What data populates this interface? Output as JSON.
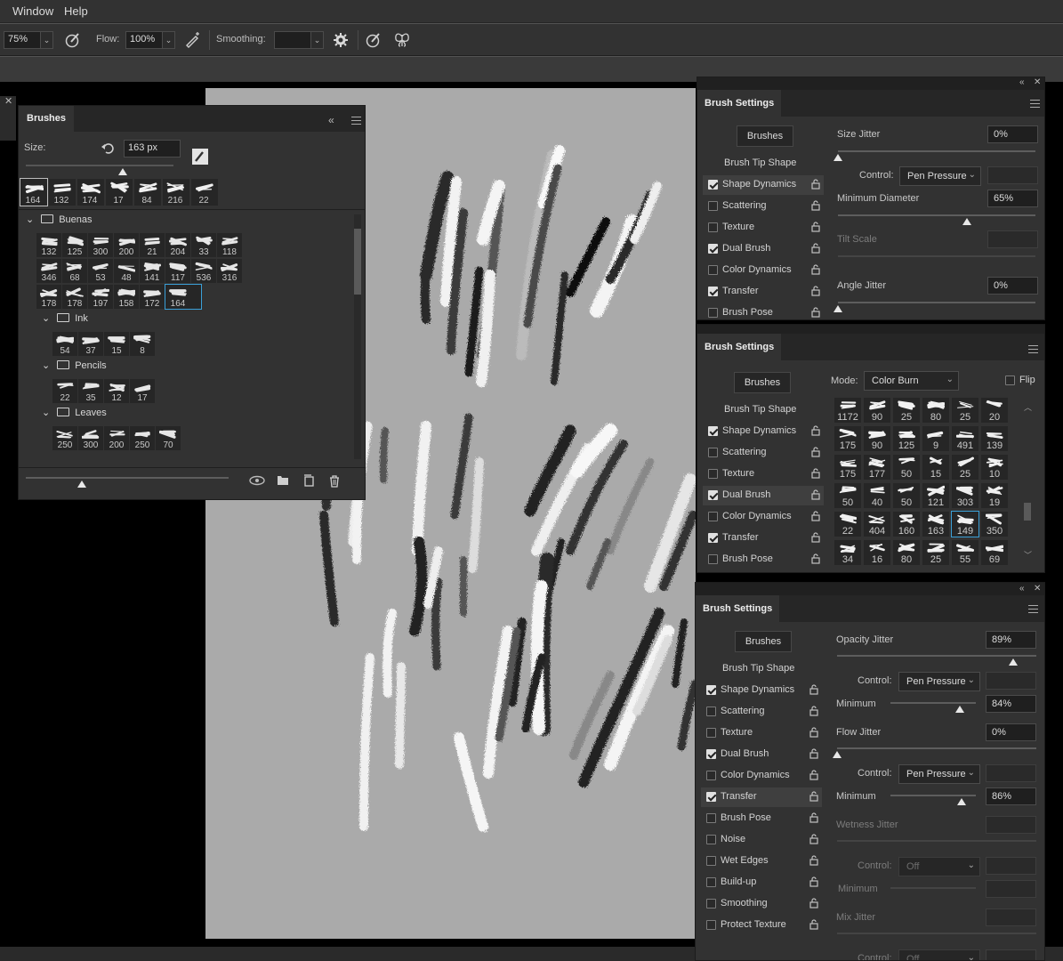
{
  "menubar": {
    "items": [
      "Window",
      "Help"
    ]
  },
  "options_bar": {
    "opacity_value": "75%",
    "flow_label": "Flow:",
    "flow_value": "100%",
    "smoothing_label": "Smoothing:",
    "smoothing_value": ""
  },
  "brushes_panel": {
    "title": "Brushes",
    "size_label": "Size:",
    "size_value": "163 px",
    "recent": [
      "164",
      "132",
      "174",
      "17",
      "84",
      "216",
      "22"
    ],
    "groups": [
      {
        "name": "Buenas",
        "rows": [
          [
            "132",
            "125",
            "300",
            "200",
            "21",
            "204",
            "33",
            "118"
          ],
          [
            "346",
            "68",
            "53",
            "48",
            "141",
            "117",
            "536",
            "316"
          ],
          [
            "178",
            "178",
            "197",
            "158",
            "172",
            "164"
          ]
        ]
      },
      {
        "name": "Ink",
        "rows": [
          [
            "54",
            "37",
            "15",
            "8"
          ]
        ]
      },
      {
        "name": "Pencils",
        "rows": [
          [
            "22",
            "35",
            "12",
            "17"
          ]
        ]
      },
      {
        "name": "Leaves",
        "rows": [
          [
            "250",
            "300",
            "200",
            "250",
            "70"
          ]
        ]
      }
    ]
  },
  "bs1": {
    "title": "Brush Settings",
    "brushes_button": "Brushes",
    "items": [
      {
        "label": "Brush Tip Shape",
        "checkbox": null
      },
      {
        "label": "Shape Dynamics",
        "checkbox": true,
        "selected": true
      },
      {
        "label": "Scattering",
        "checkbox": false
      },
      {
        "label": "Texture",
        "checkbox": false
      },
      {
        "label": "Dual Brush",
        "checkbox": true
      },
      {
        "label": "Color Dynamics",
        "checkbox": false
      },
      {
        "label": "Transfer",
        "checkbox": true
      },
      {
        "label": "Brush Pose",
        "checkbox": false
      }
    ],
    "size_jitter_label": "Size Jitter",
    "size_jitter_value": "0%",
    "control_label": "Control:",
    "control_value": "Pen Pressure",
    "min_diameter_label": "Minimum Diameter",
    "min_diameter_value": "65%",
    "tilt_scale_label": "Tilt Scale",
    "angle_jitter_label": "Angle Jitter",
    "angle_jitter_value": "0%"
  },
  "bs2": {
    "title": "Brush Settings",
    "brushes_button": "Brushes",
    "mode_label": "Mode:",
    "mode_value": "Color Burn",
    "flip_label": "Flip",
    "items": [
      {
        "label": "Brush Tip Shape",
        "checkbox": null
      },
      {
        "label": "Shape Dynamics",
        "checkbox": true
      },
      {
        "label": "Scattering",
        "checkbox": false
      },
      {
        "label": "Texture",
        "checkbox": false
      },
      {
        "label": "Dual Brush",
        "checkbox": true,
        "selected": true
      },
      {
        "label": "Color Dynamics",
        "checkbox": false
      },
      {
        "label": "Transfer",
        "checkbox": true
      },
      {
        "label": "Brush Pose",
        "checkbox": false
      }
    ],
    "tips": [
      [
        "1172",
        "90",
        "25",
        "80",
        "25",
        "20"
      ],
      [
        "175",
        "90",
        "125",
        "9",
        "491",
        "139"
      ],
      [
        "175",
        "177",
        "50",
        "15",
        "25",
        "10"
      ],
      [
        "50",
        "40",
        "50",
        "121",
        "303",
        "19"
      ],
      [
        "22",
        "404",
        "160",
        "163",
        "149",
        "350"
      ],
      [
        "34",
        "16",
        "80",
        "25",
        "55",
        "69"
      ]
    ]
  },
  "bs3": {
    "title": "Brush Settings",
    "brushes_button": "Brushes",
    "items": [
      {
        "label": "Brush Tip Shape",
        "checkbox": null
      },
      {
        "label": "Shape Dynamics",
        "checkbox": true
      },
      {
        "label": "Scattering",
        "checkbox": false
      },
      {
        "label": "Texture",
        "checkbox": false
      },
      {
        "label": "Dual Brush",
        "checkbox": true
      },
      {
        "label": "Color Dynamics",
        "checkbox": false
      },
      {
        "label": "Transfer",
        "checkbox": true,
        "selected": true
      },
      {
        "label": "Brush Pose",
        "checkbox": false
      },
      {
        "label": "Noise",
        "checkbox": false
      },
      {
        "label": "Wet Edges",
        "checkbox": false
      },
      {
        "label": "Build-up",
        "checkbox": false
      },
      {
        "label": "Smoothing",
        "checkbox": false
      },
      {
        "label": "Protect Texture",
        "checkbox": false
      }
    ],
    "opacity_jitter_label": "Opacity Jitter",
    "opacity_jitter_value": "89%",
    "control_label": "Control:",
    "control_value": "Pen Pressure",
    "minimum_label": "Minimum",
    "minimum1_value": "84%",
    "flow_jitter_label": "Flow Jitter",
    "flow_jitter_value": "0%",
    "control2_value": "Pen Pressure",
    "minimum2_value": "86%",
    "wetness_jitter_label": "Wetness Jitter",
    "control3_value": "Off",
    "mix_jitter_label": "Mix Jitter",
    "control4_value": "Off"
  }
}
